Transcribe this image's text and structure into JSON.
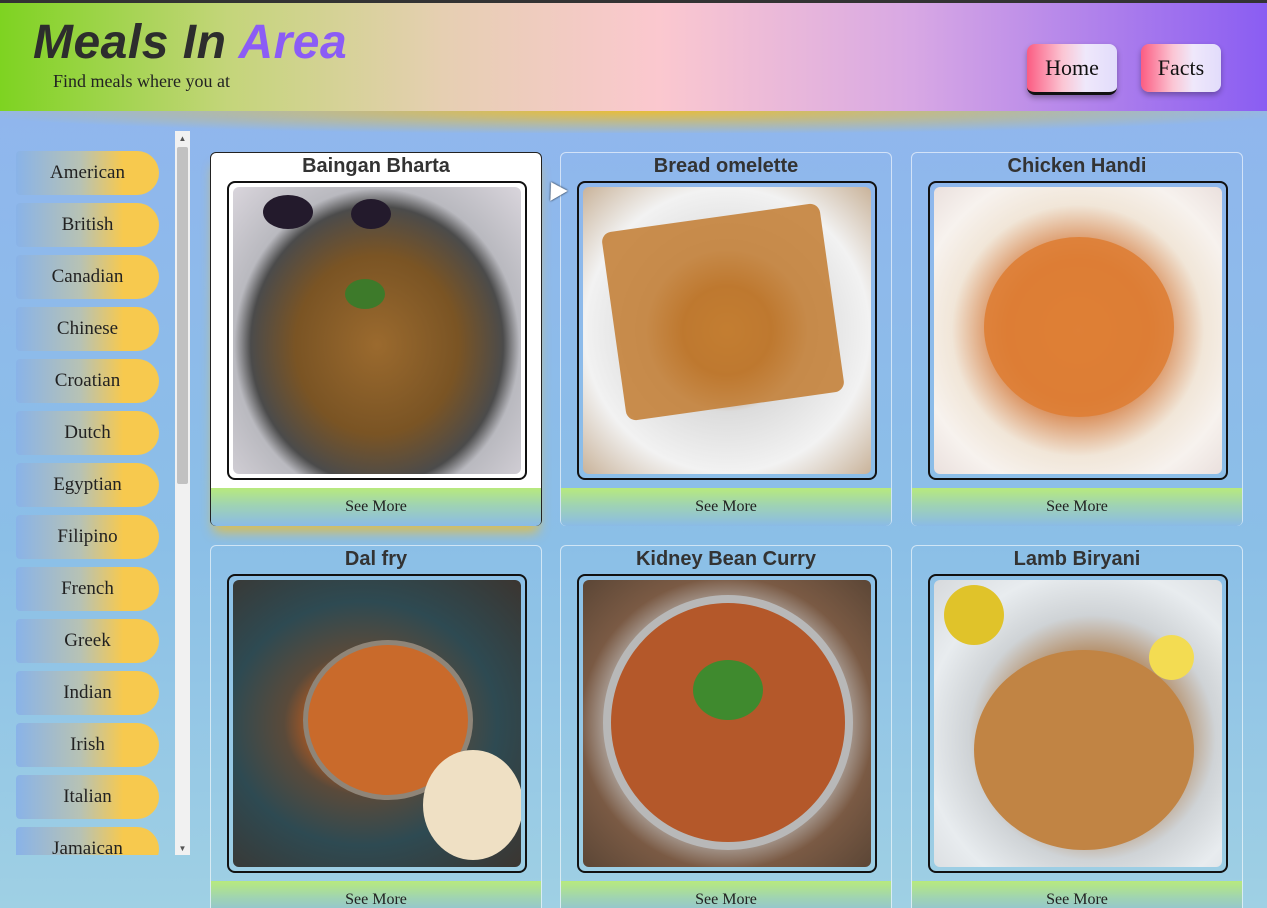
{
  "header": {
    "brand_main": "Meals In ",
    "brand_accent": "Area",
    "tagline": "Find meals where you at",
    "nav": [
      {
        "label": "Home"
      },
      {
        "label": "Facts"
      }
    ]
  },
  "sidebar": {
    "areas": [
      "American",
      "British",
      "Canadian",
      "Chinese",
      "Croatian",
      "Dutch",
      "Egyptian",
      "Filipino",
      "French",
      "Greek",
      "Indian",
      "Irish",
      "Italian",
      "Jamaican"
    ]
  },
  "meals": [
    {
      "name": "Baingan Bharta",
      "button": "See More"
    },
    {
      "name": "Bread omelette",
      "button": "See More"
    },
    {
      "name": "Chicken Handi",
      "button": "See More"
    },
    {
      "name": "Dal fry",
      "button": "See More"
    },
    {
      "name": "Kidney Bean Curry",
      "button": "See More"
    },
    {
      "name": "Lamb Biryani",
      "button": "See More"
    }
  ],
  "colors": {
    "brand_accent": "#8b5cf6",
    "nav_pink": "#fb5c82",
    "sidebar_gold": "#f7c94e",
    "button_green": "#b8ea7d"
  }
}
